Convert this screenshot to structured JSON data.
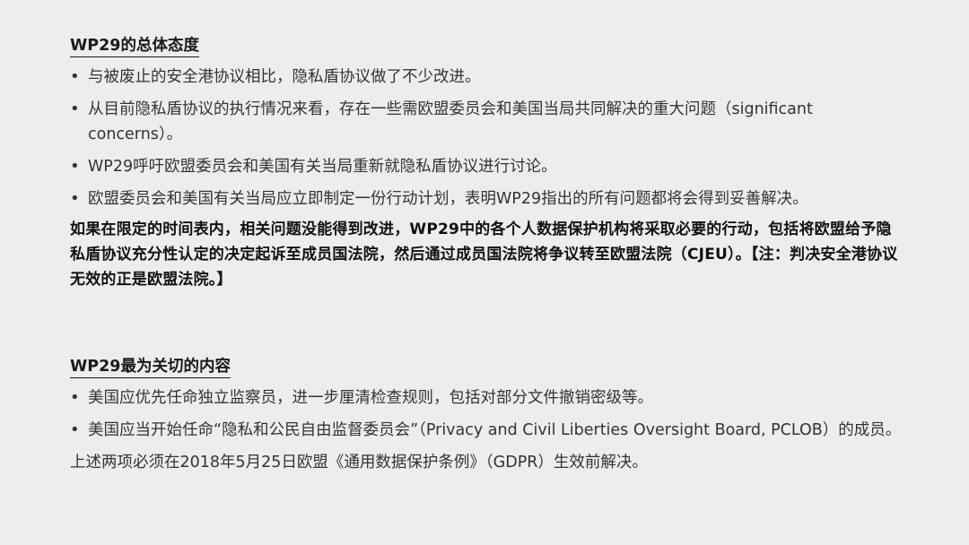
{
  "section1": {
    "heading": "WP29的总体态度",
    "bullet_glyph": "•",
    "bullets": [
      "与被废止的安全港协议相比，隐私盾协议做了不少改进。",
      "从目前隐私盾协议的执行情况来看，存在一些需欧盟委员会和美国当局共同解决的重大问题（significant concerns）。",
      "WP29呼吁欧盟委员会和美国有关当局重新就隐私盾协议进行讨论。",
      "欧盟委员会和美国有关当局应立即制定一份行动计划，表明WP29指出的所有问题都将会得到妥善解决。"
    ],
    "bold_paragraph": "如果在限定的时间表内，相关问题没能得到改进，WP29中的各个人数据保护机构将采取必要的行动，包括将欧盟给予隐私盾协议充分性认定的决定起诉至成员国法院，然后通过成员国法院将争议转至欧盟法院（CJEU）。【注：判决安全港协议无效的正是欧盟法院。】"
  },
  "section2": {
    "heading": "WP29最为关切的内容",
    "bullet_glyph": "•",
    "bullets": [
      "美国应优先任命独立监察员，进一步厘清检查规则，包括对部分文件撤销密级等。",
      "美国应当开始任命“隐私和公民自由监督委员会”（Privacy and Civil Liberties Oversight Board, PCLOB）的成员。"
    ],
    "closing": "上述两项必须在2018年5月25日欧盟《通用数据保护条例》（GDPR）生效前解决。"
  }
}
